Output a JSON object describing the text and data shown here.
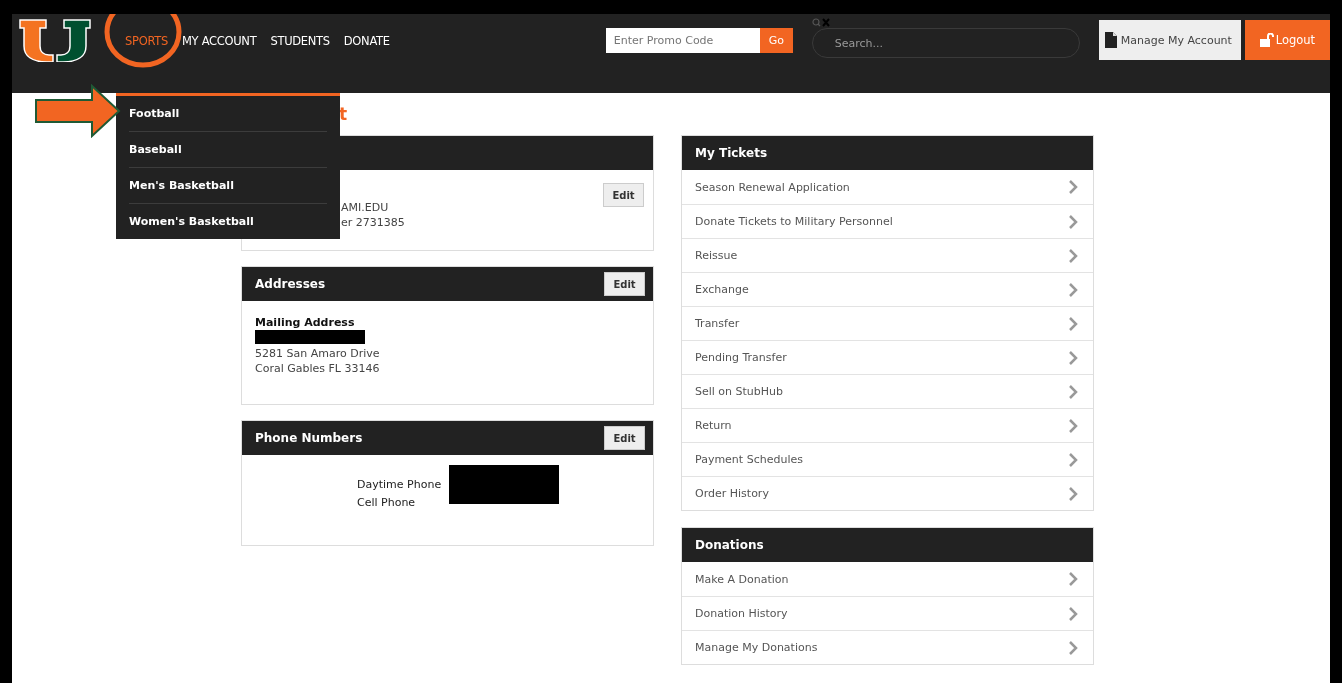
{
  "header": {
    "nav": [
      {
        "label": "SPORTS",
        "selected": true
      },
      {
        "label": "MY ACCOUNT",
        "selected": false
      },
      {
        "label": "STUDENTS",
        "selected": false
      },
      {
        "label": "DONATE",
        "selected": false
      }
    ],
    "promo": {
      "placeholder": "Enter Promo Code",
      "button": "Go"
    },
    "search": {
      "placeholder": "Search..."
    },
    "manage_button": "Manage My Account",
    "logout_button": "Logout"
  },
  "sports_menu": [
    "Football",
    "Baseball",
    "Men's Basketball",
    "Women's Basketball"
  ],
  "page_title": "t",
  "contact_card": {
    "lines": [
      "AMI.EDU",
      "er 2731385"
    ],
    "edit": "Edit"
  },
  "addresses": {
    "title": "Addresses",
    "edit": "Edit",
    "label": "Mailing Address",
    "lines": [
      "5281 San Amaro Drive",
      "Coral Gables FL 33146"
    ]
  },
  "phone": {
    "title": "Phone Numbers",
    "edit": "Edit",
    "labels": [
      "Daytime Phone",
      "Cell Phone"
    ]
  },
  "tickets": {
    "title": "My Tickets",
    "items": [
      "Season Renewal Application",
      "Donate Tickets to Military Personnel",
      "Reissue",
      "Exchange",
      "Transfer",
      "Pending Transfer",
      "Sell on StubHub",
      "Return",
      "Payment Schedules",
      "Order History"
    ]
  },
  "donations": {
    "title": "Donations",
    "items": [
      "Make A Donation",
      "Donation History",
      "Manage My Donations"
    ]
  }
}
